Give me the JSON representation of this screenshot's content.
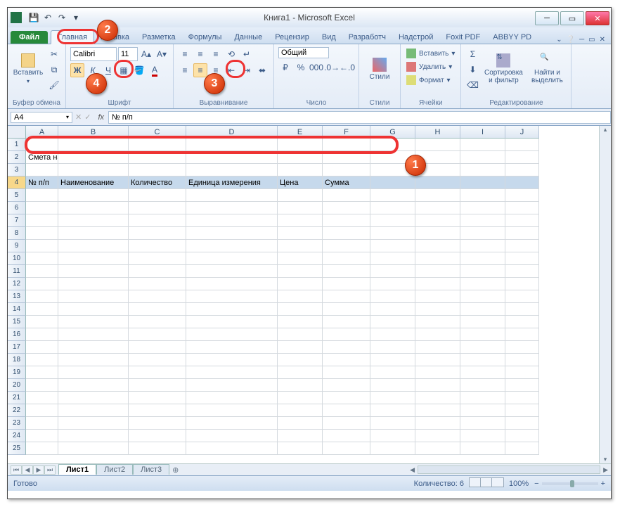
{
  "title": "Книга1 - Microsoft Excel",
  "qat": {
    "save": "💾",
    "undo": "↶",
    "redo": "↷"
  },
  "tabs": {
    "file": "Файл",
    "items": [
      "Главная",
      "Вставка",
      "Разметка",
      "Формулы",
      "Данные",
      "Рецензир",
      "Вид",
      "Разработч",
      "Надстрой",
      "Foxit PDF",
      "ABBYY PD"
    ],
    "active": 0
  },
  "ribbon": {
    "clipboard": {
      "paste": "Вставить",
      "label": "Буфер обмена"
    },
    "font": {
      "name": "Calibri",
      "size": "11",
      "label": "Шрифт",
      "bold": "Ж",
      "italic": "К",
      "underline": "Ч"
    },
    "align": {
      "label": "Выравнивание"
    },
    "number": {
      "format": "Общий",
      "label": "Число"
    },
    "styles": {
      "btn": "Стили",
      "label": "Стили"
    },
    "cells": {
      "insert": "Вставить",
      "delete": "Удалить",
      "format": "Формат",
      "label": "Ячейки"
    },
    "editing": {
      "sort": "Сортировка и фильтр",
      "find": "Найти и выделить",
      "label": "Редактирование"
    }
  },
  "namebox": "A4",
  "formula": "№ п/п",
  "columns": [
    "A",
    "B",
    "C",
    "D",
    "E",
    "F",
    "G",
    "H",
    "I",
    "J"
  ],
  "sheet": {
    "r2": {
      "A": "Смета на работы"
    },
    "r4": {
      "A": "№ п/п",
      "B": "Наименование",
      "C": "Количество",
      "D": "Единица измерения",
      "E": "Цена",
      "F": "Сумма"
    }
  },
  "sheets": {
    "s1": "Лист1",
    "s2": "Лист2",
    "s3": "Лист3"
  },
  "status": {
    "ready": "Готово",
    "count": "Количество: 6",
    "zoom": "100%"
  },
  "callouts": {
    "c1": "1",
    "c2": "2",
    "c3": "3",
    "c4": "4"
  }
}
